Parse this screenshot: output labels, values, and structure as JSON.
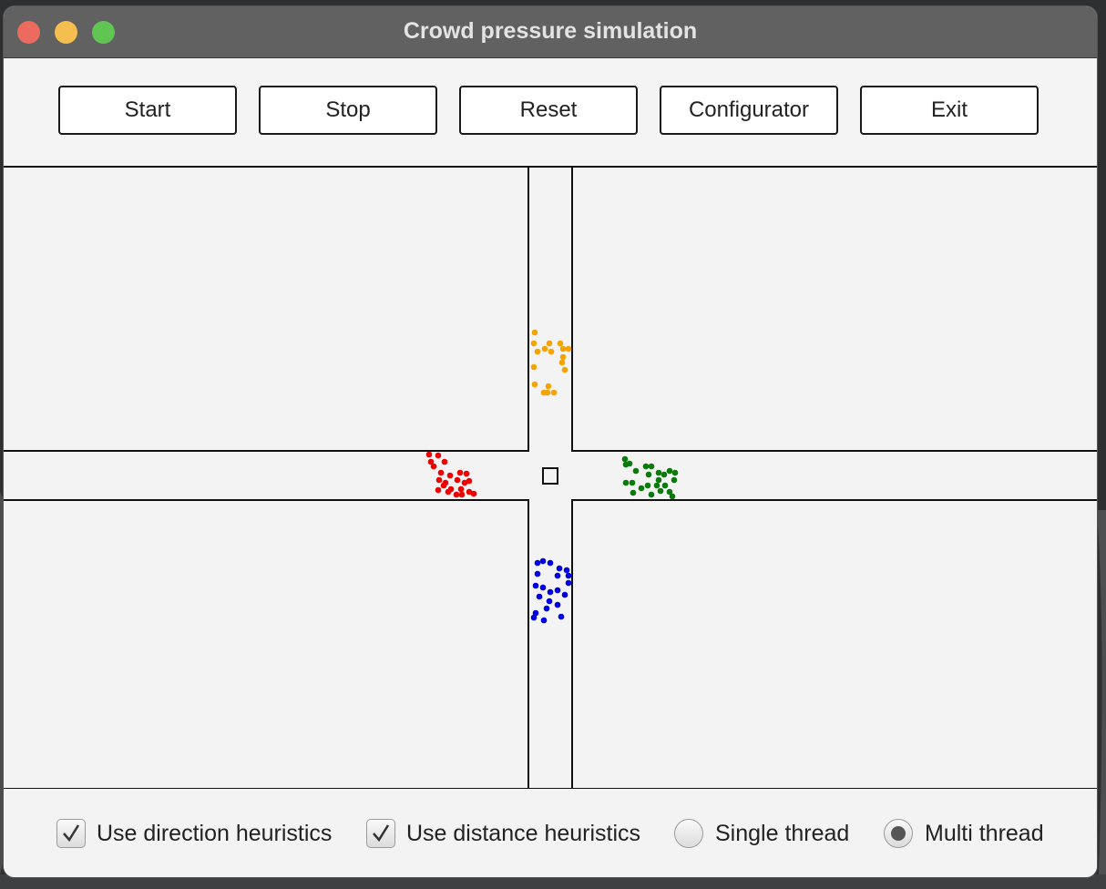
{
  "window": {
    "title": "Crowd pressure simulation"
  },
  "toolbar": {
    "buttons": [
      {
        "label": "Start"
      },
      {
        "label": "Stop"
      },
      {
        "label": "Reset"
      },
      {
        "label": "Configurator"
      },
      {
        "label": "Exit"
      }
    ]
  },
  "simulation": {
    "groups": [
      {
        "name": "north",
        "color": "#f5a300",
        "agents": [
          [
            587,
            365
          ],
          [
            586,
            377
          ],
          [
            590,
            386
          ],
          [
            598,
            383
          ],
          [
            603,
            377
          ],
          [
            605,
            386
          ],
          [
            615,
            377
          ],
          [
            618,
            383
          ],
          [
            624,
            383
          ],
          [
            618,
            392
          ],
          [
            617,
            398
          ],
          [
            620,
            406
          ],
          [
            586,
            403
          ],
          [
            587,
            422
          ],
          [
            597,
            431
          ],
          [
            602,
            424
          ],
          [
            608,
            431
          ],
          [
            601,
            431
          ]
        ]
      },
      {
        "name": "west",
        "color": "#ee0000",
        "agents": [
          [
            471,
            499
          ],
          [
            481,
            500
          ],
          [
            473,
            507
          ],
          [
            476,
            512
          ],
          [
            488,
            507
          ],
          [
            484,
            519
          ],
          [
            494,
            522
          ],
          [
            482,
            527
          ],
          [
            489,
            530
          ],
          [
            492,
            540
          ],
          [
            481,
            538
          ],
          [
            487,
            533
          ],
          [
            505,
            519
          ],
          [
            512,
            520
          ],
          [
            502,
            527
          ],
          [
            510,
            530
          ],
          [
            515,
            528
          ],
          [
            506,
            537
          ],
          [
            501,
            543
          ],
          [
            507,
            543
          ],
          [
            515,
            540
          ],
          [
            520,
            542
          ],
          [
            495,
            537
          ]
        ]
      },
      {
        "name": "east",
        "color": "#0a7a0a",
        "agents": [
          [
            686,
            504
          ],
          [
            691,
            509
          ],
          [
            687,
            510
          ],
          [
            698,
            517
          ],
          [
            709,
            512
          ],
          [
            715,
            512
          ],
          [
            712,
            521
          ],
          [
            723,
            519
          ],
          [
            729,
            521
          ],
          [
            735,
            517
          ],
          [
            741,
            519
          ],
          [
            740,
            527
          ],
          [
            723,
            527
          ],
          [
            721,
            533
          ],
          [
            725,
            539
          ],
          [
            730,
            533
          ],
          [
            735,
            540
          ],
          [
            738,
            545
          ],
          [
            715,
            543
          ],
          [
            711,
            533
          ],
          [
            704,
            536
          ],
          [
            695,
            541
          ],
          [
            687,
            530
          ],
          [
            694,
            530
          ]
        ]
      },
      {
        "name": "south",
        "color": "#0000e0",
        "agents": [
          [
            590,
            618
          ],
          [
            596,
            616
          ],
          [
            604,
            618
          ],
          [
            614,
            624
          ],
          [
            612,
            632
          ],
          [
            590,
            630
          ],
          [
            588,
            643
          ],
          [
            596,
            645
          ],
          [
            604,
            650
          ],
          [
            612,
            648
          ],
          [
            622,
            626
          ],
          [
            624,
            640
          ],
          [
            620,
            653
          ],
          [
            592,
            655
          ],
          [
            603,
            660
          ],
          [
            612,
            664
          ],
          [
            600,
            668
          ],
          [
            588,
            673
          ],
          [
            586,
            678
          ],
          [
            597,
            681
          ],
          [
            616,
            677
          ],
          [
            624,
            632
          ]
        ]
      }
    ]
  },
  "options": {
    "direction_heuristics": {
      "label": "Use direction heuristics",
      "checked": true
    },
    "distance_heuristics": {
      "label": "Use distance heuristics",
      "checked": true
    },
    "single_thread": {
      "label": "Single thread",
      "selected": false
    },
    "multi_thread": {
      "label": "Multi thread",
      "selected": true
    }
  }
}
